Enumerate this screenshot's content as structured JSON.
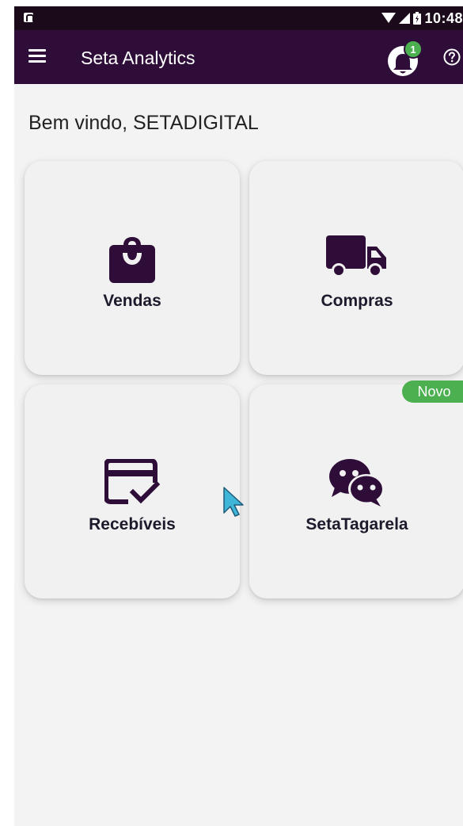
{
  "status_bar": {
    "time": "10:48"
  },
  "app_bar": {
    "title": "Seta Analytics",
    "notification_count": "1"
  },
  "greeting": "Bem vindo, SETADIGITAL",
  "cards": [
    {
      "label": "Vendas",
      "icon": "shopping-bag-icon"
    },
    {
      "label": "Compras",
      "icon": "truck-icon"
    },
    {
      "label": "Recebíveis",
      "icon": "card-check-icon"
    },
    {
      "label": "SetaTagarela",
      "icon": "chat-bubbles-icon"
    }
  ],
  "badge": {
    "novo": "Novo"
  },
  "colors": {
    "app_bar": "#2e0e38",
    "status_bar": "#1a0a1a",
    "background": "#f3f3f3",
    "card": "#f1f1f1",
    "icon": "#2e0e38",
    "accent_green": "#4caf50"
  }
}
